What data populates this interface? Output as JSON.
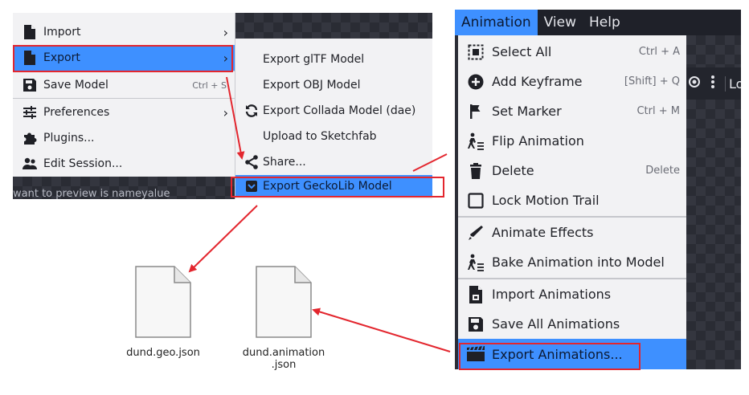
{
  "left_menu": {
    "items": [
      {
        "label": "Import",
        "icon": "file-icon",
        "arrow": true
      },
      {
        "label": "Export",
        "icon": "file-icon",
        "arrow": true,
        "highlighted": true
      },
      {
        "label": "Save Model",
        "icon": "save-icon",
        "shortcut": "Ctrl + S"
      },
      {
        "label": "Preferences",
        "icon": "sliders-icon",
        "arrow": true
      },
      {
        "label": "Plugins...",
        "icon": "puzzle-icon"
      },
      {
        "label": "Edit Session...",
        "icon": "users-icon"
      }
    ],
    "background_text": "want to preview is nameyalue"
  },
  "export_submenu": {
    "items": [
      {
        "label": "Export glTF Model"
      },
      {
        "label": "Export OBJ Model"
      },
      {
        "label": "Export Collada Model (dae)",
        "icon": "sync-icon"
      },
      {
        "label": "Upload to Sketchfab"
      },
      {
        "label": "Share...",
        "icon": "share-icon"
      },
      {
        "label": "Export GeckoLib Model",
        "icon": "gecko-icon",
        "highlighted": true
      }
    ]
  },
  "menubar": {
    "items": [
      "Animation",
      "View",
      "Help"
    ],
    "active": "Animation"
  },
  "toolbar_right": {
    "text": "Lo"
  },
  "animation_menu": {
    "items": [
      {
        "label": "Select All",
        "icon": "select-all-icon",
        "shortcut": "Ctrl + A"
      },
      {
        "label": "Add Keyframe",
        "icon": "add-circle-icon",
        "shortcut": "[Shift] + Q"
      },
      {
        "label": "Set Marker",
        "icon": "flag-icon",
        "shortcut": "Ctrl + M"
      },
      {
        "label": "Flip Animation",
        "icon": "flip-walk-icon"
      },
      {
        "label": "Delete",
        "icon": "trash-icon",
        "shortcut": "Delete"
      },
      {
        "label": "Lock Motion Trail",
        "icon": "checkbox-icon"
      },
      {
        "label": "Animate Effects",
        "icon": "brush-icon"
      },
      {
        "label": "Bake Animation into Model",
        "icon": "bake-walk-icon"
      },
      {
        "label": "Import Animations",
        "icon": "file-import-icon"
      },
      {
        "label": "Save All Animations",
        "icon": "save-icon"
      },
      {
        "label": "Export Animations...",
        "icon": "clapperboard-icon",
        "highlighted": true
      }
    ]
  },
  "files": [
    {
      "name": "dund.geo.json"
    },
    {
      "name_line1": "dund.animation",
      "name_line2": ".json"
    }
  ],
  "colors": {
    "highlight": "#3e90ff",
    "annotation_red": "#e3262e",
    "menu_bg": "#f2f2f4",
    "dark_bg": "#2b2d36"
  }
}
